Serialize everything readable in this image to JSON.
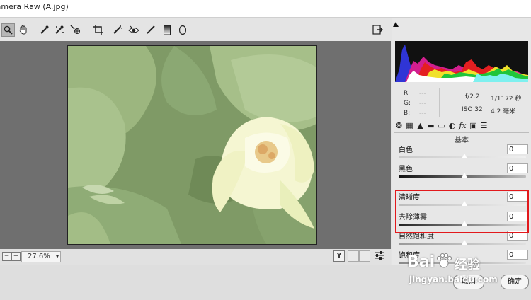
{
  "window": {
    "title": "Camera Raw (A.jpg)"
  },
  "toolbar": {
    "tools": [
      {
        "name": "zoom-tool",
        "glyph": "🔍"
      },
      {
        "name": "hand-tool",
        "glyph": "✋"
      },
      {
        "name": "white-balance-tool",
        "glyph": "⁄"
      },
      {
        "name": "color-sampler-tool",
        "glyph": "⁄"
      },
      {
        "name": "targeted-adjustment-tool",
        "glyph": "⊕"
      },
      {
        "name": "crop-tool",
        "glyph": "⌗"
      },
      {
        "name": "spot-removal-tool",
        "glyph": "✎"
      },
      {
        "name": "red-eye-tool",
        "glyph": "◉"
      },
      {
        "name": "adjustment-brush-tool",
        "glyph": "✏"
      },
      {
        "name": "graduated-filter-tool",
        "glyph": "▮"
      },
      {
        "name": "radial-filter-tool",
        "glyph": "○"
      }
    ],
    "export_glyph": "⇲"
  },
  "status": {
    "zoom_value": "27.6%",
    "minus": "−",
    "plus": "+",
    "y_button": "Y"
  },
  "info": {
    "r_label": "R:",
    "r_value": "---",
    "g_label": "G:",
    "g_value": "---",
    "b_label": "B:",
    "b_value": "---",
    "aperture": "f/2.2",
    "shutter": "1/1172 秒",
    "iso": "ISO 32",
    "focal": "4.2 毫米"
  },
  "panel_tabs": [
    "❂",
    "▦",
    "▲",
    "▬",
    "▭",
    "◐",
    "fx",
    "▣",
    "☰"
  ],
  "section": {
    "title": "基本"
  },
  "sliders": [
    {
      "label": "白色",
      "value": "0",
      "colors": [
        "#c9c9c9",
        "#f0f0f0"
      ]
    },
    {
      "label": "黑色",
      "value": "0",
      "colors": [
        "#111111",
        "#bdbdbd"
      ]
    },
    {
      "label": "清晰度",
      "value": "0",
      "colors": [
        "#bdbdbd",
        "#eeeeee"
      ]
    },
    {
      "label": "去除薄雾",
      "value": "0",
      "colors": [
        "#222222",
        "#d8d8d8"
      ]
    },
    {
      "label": "自然饱和度",
      "value": "0",
      "colors": [
        "#9a9a9a",
        "#e0e0e0"
      ]
    },
    {
      "label": "饱和度",
      "value": "0",
      "colors": [
        "#888888",
        "#e0e0e0"
      ]
    }
  ],
  "buttons": {
    "cancel": "取消",
    "ok": "确定"
  },
  "watermark": {
    "brand": "Bai",
    "paw": "🐾",
    "cn": "经验",
    "url": "jingyan.baidu.com"
  },
  "colors": {
    "highlight": "#e2191c",
    "preview_bg": "#6f6f6f"
  }
}
